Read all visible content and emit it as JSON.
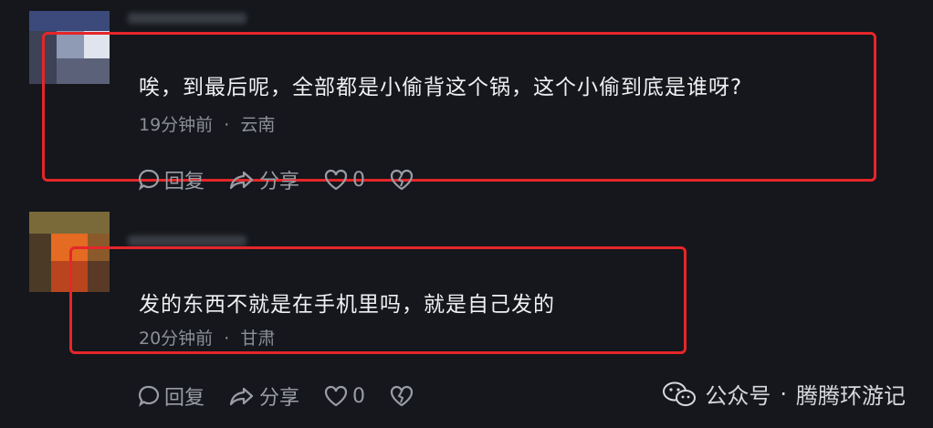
{
  "comments": [
    {
      "text": "唉，到最后呢，全部都是小偷背这个锅，这个小偷到底是谁呀?",
      "time": "19分钟前",
      "separator": "·",
      "location": "云南",
      "actions": {
        "reply": "回复",
        "share": "分享",
        "likes": "0"
      }
    },
    {
      "text": "发的东西不就是在手机里吗，就是自己发的",
      "time": "20分钟前",
      "separator": "·",
      "location": "甘肃",
      "actions": {
        "reply": "回复",
        "share": "分享",
        "likes": "0"
      }
    }
  ],
  "watermark": {
    "label": "公众号",
    "separator": "·",
    "account": "腾腾环游记"
  },
  "icons": [
    "comment-icon",
    "share-icon",
    "like-heart-icon",
    "broken-heart-icon",
    "wechat-icon"
  ],
  "colors": {
    "background": "#15171c",
    "highlight": "#e5262a",
    "meta": "#8c8f98"
  }
}
